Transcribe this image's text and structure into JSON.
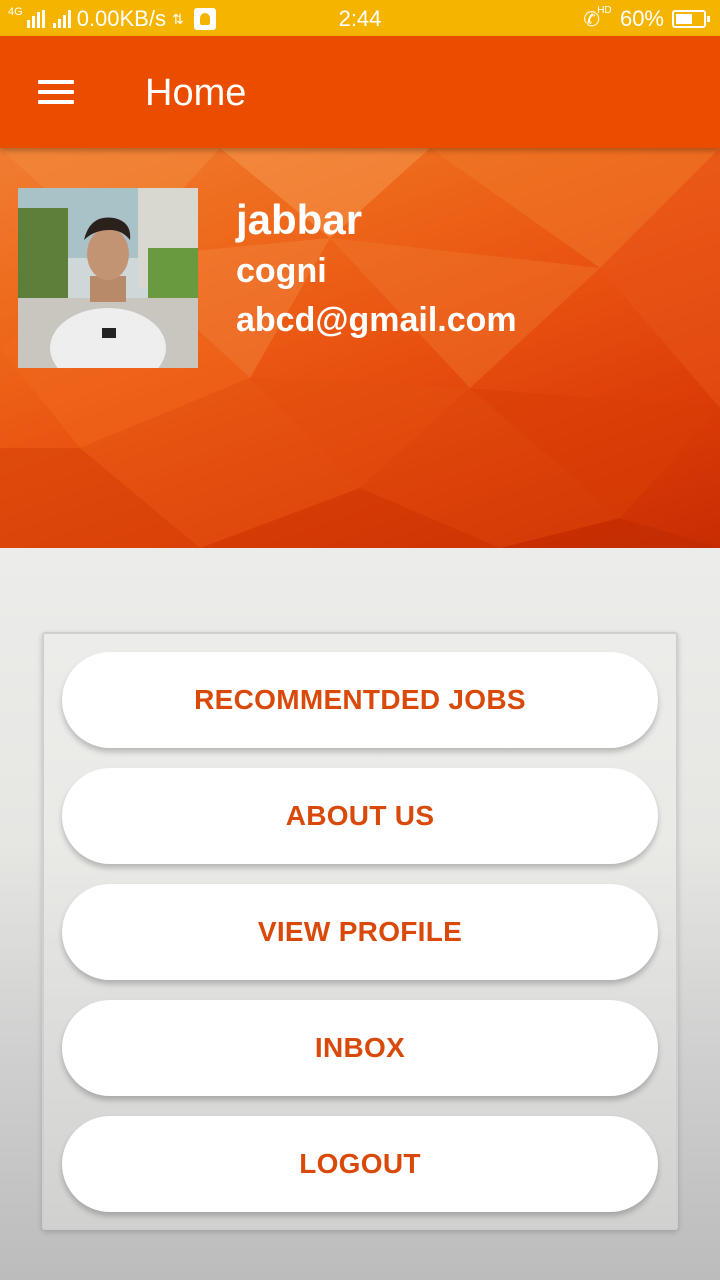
{
  "status_bar": {
    "network": "4G",
    "speed": "0.00KB/s",
    "time": "2:44",
    "hd": "HD",
    "battery": "60%",
    "battery_level": 0.6
  },
  "toolbar": {
    "title": "Home",
    "menu_icon": "hamburger-menu-icon"
  },
  "profile": {
    "name": "jabbar",
    "company": "cogni",
    "email": "abcd@gmail.com"
  },
  "menu": {
    "items": [
      {
        "label": "RECOMMENTDED JOBS"
      },
      {
        "label": "ABOUT US"
      },
      {
        "label": "VIEW PROFILE"
      },
      {
        "label": "INBOX"
      },
      {
        "label": "LOGOUT"
      }
    ]
  },
  "colors": {
    "status_bar": "#f4b400",
    "toolbar": "#ea4c00",
    "button_text": "#d94a0a"
  }
}
